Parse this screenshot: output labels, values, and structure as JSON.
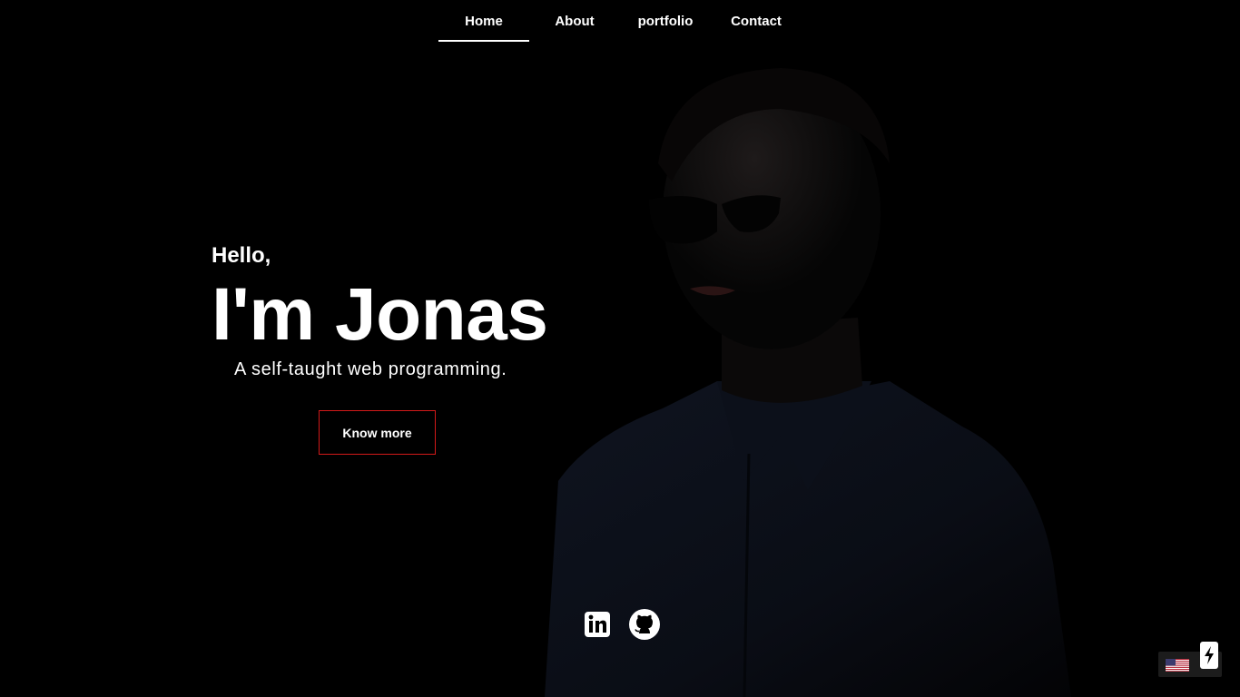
{
  "nav": {
    "items": [
      {
        "label": "Home",
        "active": true
      },
      {
        "label": "About",
        "active": false
      },
      {
        "label": "portfolio",
        "active": false
      },
      {
        "label": "Contact",
        "active": false
      }
    ]
  },
  "hero": {
    "greeting": "Hello,",
    "name": "I'm Jonas",
    "tagline": "A self-taught web programming.",
    "cta_label": "Know more"
  },
  "socials": {
    "items": [
      {
        "icon": "linkedin-icon"
      },
      {
        "icon": "github-icon"
      }
    ]
  },
  "language": {
    "icon": "us-flag-icon"
  },
  "colors": {
    "background": "#000000",
    "text": "#ffffff",
    "accent": "#d31a1a"
  }
}
